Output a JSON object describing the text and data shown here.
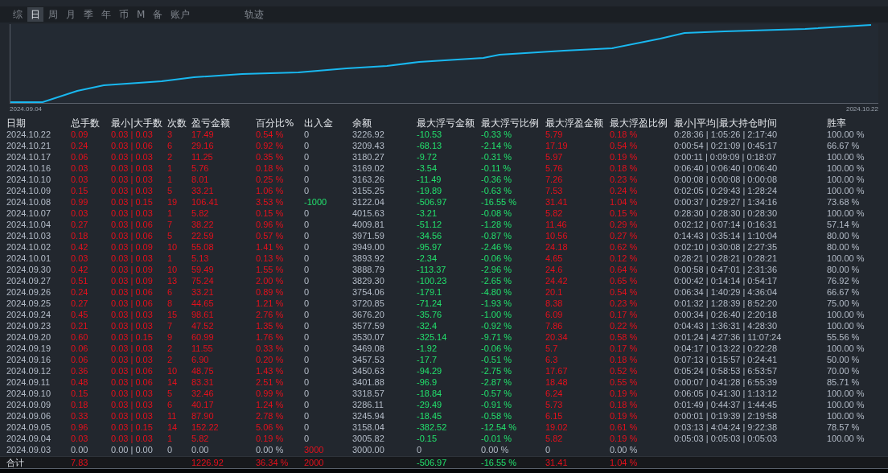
{
  "tabs": [
    {
      "label": "综",
      "selected": false
    },
    {
      "label": "日",
      "selected": true
    },
    {
      "label": "周",
      "selected": false
    },
    {
      "label": "月",
      "selected": false
    },
    {
      "label": "季",
      "selected": false
    },
    {
      "label": "年",
      "selected": false
    },
    {
      "label": "币",
      "selected": false
    },
    {
      "label": "M",
      "selected": false
    },
    {
      "label": "备",
      "selected": false
    },
    {
      "label": "账户",
      "selected": false
    },
    {
      "label": "轨迹",
      "selected": false
    }
  ],
  "chart": {
    "start_label": "2024.09.04",
    "end_label": "2024.10.22"
  },
  "table": {
    "columns": [
      {
        "label": "日期",
        "kind": "neutral"
      },
      {
        "label": "总手数",
        "kind": "gain"
      },
      {
        "label": "最小|大手数",
        "kind": "gain"
      },
      {
        "label": "次数",
        "kind": "gain"
      },
      {
        "label": "盈亏金额",
        "kind": "gain"
      },
      {
        "label": "百分比%",
        "kind": "gain"
      },
      {
        "label": "出入金",
        "kind": "neutral"
      },
      {
        "label": "余额",
        "kind": "neutral"
      },
      {
        "label": "最大浮亏金额",
        "kind": "loss"
      },
      {
        "label": "最大浮亏比例",
        "kind": "loss"
      },
      {
        "label": "最大浮盈金额",
        "kind": "gain"
      },
      {
        "label": "最大浮盈比例",
        "kind": "gain"
      },
      {
        "label": "最小|平均|最大持仓时间",
        "kind": "neutral"
      },
      {
        "label": "胜率",
        "kind": "neutral"
      }
    ],
    "rows": [
      {
        "cells": [
          "2024.10.22",
          "0.09",
          "0.03 | 0.03",
          "3",
          "17.49",
          "0.54 %",
          "0",
          "3226.92",
          "-10.53",
          "-0.33 %",
          "5.79",
          "0.18 %",
          "0:28:36 | 1:05:26 | 2:17:40",
          "100.00 %"
        ]
      },
      {
        "cells": [
          "2024.10.21",
          "0.24",
          "0.03 | 0.06",
          "6",
          "29.16",
          "0.92 %",
          "0",
          "3209.43",
          "-68.13",
          "-2.14 %",
          "17.19",
          "0.54 %",
          "0:00:54 | 0:21:09 | 0:45:17",
          "66.67 %"
        ]
      },
      {
        "cells": [
          "2024.10.17",
          "0.06",
          "0.03 | 0.03",
          "2",
          "11.25",
          "0.35 %",
          "0",
          "3180.27",
          "-9.72",
          "-0.31 %",
          "5.97",
          "0.19 %",
          "0:00:11 | 0:09:09 | 0:18:07",
          "100.00 %"
        ]
      },
      {
        "cells": [
          "2024.10.16",
          "0.03",
          "0.03 | 0.03",
          "1",
          "5.76",
          "0.18 %",
          "0",
          "3169.02",
          "-3.54",
          "-0.11 %",
          "5.76",
          "0.18 %",
          "0:06:40 | 0:06:40 | 0:06:40",
          "100.00 %"
        ]
      },
      {
        "cells": [
          "2024.10.10",
          "0.03",
          "0.03 | 0.03",
          "1",
          "8.01",
          "0.25 %",
          "0",
          "3163.26",
          "-11.49",
          "-0.36 %",
          "7.26",
          "0.23 %",
          "0:00:08 | 0:00:08 | 0:00:08",
          "100.00 %"
        ]
      },
      {
        "cells": [
          "2024.10.09",
          "0.15",
          "0.03 | 0.03",
          "5",
          "33.21",
          "1.06 %",
          "0",
          "3155.25",
          "-19.89",
          "-0.63 %",
          "7.53",
          "0.24 %",
          "0:02:05 | 0:29:43 | 1:28:24",
          "100.00 %"
        ]
      },
      {
        "cells": [
          "2024.10.08",
          "0.99",
          "0.03 | 0.15",
          "19",
          "106.41",
          "3.53 %",
          {
            "text": "-1000",
            "kind": "loss"
          },
          "3122.04",
          "-506.97",
          "-16.55 %",
          "31.41",
          "1.04 %",
          "0:00:37 | 0:29:27 | 1:34:16",
          "73.68 %"
        ]
      },
      {
        "cells": [
          "2024.10.07",
          "0.03",
          "0.03 | 0.03",
          "1",
          "5.82",
          "0.15 %",
          "0",
          "4015.63",
          "-3.21",
          "-0.08 %",
          "5.82",
          "0.15 %",
          "0:28:30 | 0:28:30 | 0:28:30",
          "100.00 %"
        ]
      },
      {
        "cells": [
          "2024.10.04",
          "0.27",
          "0.03 | 0.06",
          "7",
          "38.22",
          "0.96 %",
          "0",
          "4009.81",
          "-51.12",
          "-1.28 %",
          "11.46",
          "0.29 %",
          "0:02:12 | 0:07:14 | 0:16:31",
          "57.14 %"
        ]
      },
      {
        "cells": [
          "2024.10.03",
          "0.18",
          "0.03 | 0.06",
          "5",
          "22.59",
          "0.57 %",
          "0",
          "3971.59",
          "-34.56",
          "-0.87 %",
          "10.56",
          "0.27 %",
          "0:14:43 | 0:35:14 | 1:10:04",
          "80.00 %"
        ]
      },
      {
        "cells": [
          "2024.10.02",
          "0.42",
          "0.03 | 0.09",
          "10",
          "55.08",
          "1.41 %",
          "0",
          "3949.00",
          "-95.97",
          "-2.46 %",
          "24.18",
          "0.62 %",
          "0:02:10 | 0:30:08 | 2:27:35",
          "80.00 %"
        ]
      },
      {
        "cells": [
          "2024.10.01",
          "0.03",
          "0.03 | 0.03",
          "1",
          "5.13",
          "0.13 %",
          "0",
          "3893.92",
          "-2.34",
          "-0.06 %",
          "4.65",
          "0.12 %",
          "0:28:21 | 0:28:21 | 0:28:21",
          "100.00 %"
        ]
      },
      {
        "cells": [
          "2024.09.30",
          "0.42",
          "0.03 | 0.09",
          "10",
          "59.49",
          "1.55 %",
          "0",
          "3888.79",
          "-113.37",
          "-2.96 %",
          "24.6",
          "0.64 %",
          "0:00:58 | 0:47:01 | 2:31:36",
          "80.00 %"
        ]
      },
      {
        "cells": [
          "2024.09.27",
          "0.51",
          "0.03 | 0.09",
          "13",
          "75.24",
          "2.00 %",
          "0",
          "3829.30",
          "-100.23",
          "-2.65 %",
          "24.42",
          "0.65 %",
          "0:00:42 | 0:14:14 | 0:54:17",
          "76.92 %"
        ]
      },
      {
        "cells": [
          "2024.09.26",
          "0.24",
          "0.03 | 0.06",
          "6",
          "33.21",
          "0.89 %",
          "0",
          "3754.06",
          "-179.1",
          "-4.80 %",
          "20.1",
          "0.54 %",
          "0:06:34 | 1:40:29 | 4:36:04",
          "66.67 %"
        ]
      },
      {
        "cells": [
          "2024.09.25",
          "0.27",
          "0.03 | 0.06",
          "8",
          "44.65",
          "1.21 %",
          "0",
          "3720.85",
          "-71.24",
          "-1.93 %",
          "8.38",
          "0.23 %",
          "0:01:32 | 1:28:39 | 8:52:20",
          "75.00 %"
        ]
      },
      {
        "cells": [
          "2024.09.24",
          "0.45",
          "0.03 | 0.03",
          "15",
          "98.61",
          "2.76 %",
          "0",
          "3676.20",
          "-35.76",
          "-1.00 %",
          "6.09",
          "0.17 %",
          "0:00:34 | 0:26:40 | 2:20:18",
          "100.00 %"
        ]
      },
      {
        "cells": [
          "2024.09.23",
          "0.21",
          "0.03 | 0.03",
          "7",
          "47.52",
          "1.35 %",
          "0",
          "3577.59",
          "-32.4",
          "-0.92 %",
          "7.86",
          "0.22 %",
          "0:04:43 | 1:36:31 | 4:28:30",
          "100.00 %"
        ]
      },
      {
        "cells": [
          "2024.09.20",
          "0.60",
          "0.03 | 0.15",
          "9",
          "60.99",
          "1.76 %",
          "0",
          "3530.07",
          "-325.14",
          "-9.71 %",
          "20.34",
          "0.58 %",
          "0:01:24 | 4:27:36 | 11:07:24",
          "55.56 %"
        ]
      },
      {
        "cells": [
          "2024.09.19",
          "0.06",
          "0.03 | 0.03",
          "2",
          "11.55",
          "0.33 %",
          "0",
          "3469.08",
          "-1.92",
          "-0.06 %",
          "5.7",
          "0.17 %",
          "0:04:17 | 0:13:22 | 0:22:28",
          "100.00 %"
        ]
      },
      {
        "cells": [
          "2024.09.16",
          "0.06",
          "0.03 | 0.03",
          "2",
          "6.90",
          "0.20 %",
          "0",
          "3457.53",
          "-17.7",
          "-0.51 %",
          "6.3",
          "0.18 %",
          "0:07:13 | 0:15:57 | 0:24:41",
          "50.00 %"
        ]
      },
      {
        "cells": [
          "2024.09.12",
          "0.36",
          "0.03 | 0.06",
          "10",
          "48.75",
          "1.43 %",
          "0",
          "3450.63",
          "-94.29",
          "-2.75 %",
          "17.67",
          "0.52 %",
          "0:05:24 | 0:58:53 | 6:53:57",
          "70.00 %"
        ]
      },
      {
        "cells": [
          "2024.09.11",
          "0.48",
          "0.03 | 0.06",
          "14",
          "83.31",
          "2.51 %",
          "0",
          "3401.88",
          "-96.9",
          "-2.87 %",
          "18.48",
          "0.55 %",
          "0:00:07 | 0:41:28 | 6:55:39",
          "85.71 %"
        ]
      },
      {
        "cells": [
          "2024.09.10",
          "0.15",
          "0.03 | 0.03",
          "5",
          "32.46",
          "0.99 %",
          "0",
          "3318.57",
          "-18.84",
          "-0.57 %",
          "6.24",
          "0.19 %",
          "0:06:05 | 0:41:30 | 1:13:12",
          "100.00 %"
        ]
      },
      {
        "cells": [
          "2024.09.09",
          "0.18",
          "0.03 | 0.03",
          "6",
          "40.17",
          "1.24 %",
          "0",
          "3286.11",
          "-29.49",
          "-0.91 %",
          "5.73",
          "0.18 %",
          "0:01:49 | 0:44:37 | 1:44:45",
          "100.00 %"
        ]
      },
      {
        "cells": [
          "2024.09.06",
          "0.33",
          "0.03 | 0.03",
          "11",
          "87.90",
          "2.78 %",
          "0",
          "3245.94",
          "-18.45",
          "-0.58 %",
          "6.15",
          "0.19 %",
          "0:00:01 | 0:19:39 | 2:19:58",
          "100.00 %"
        ]
      },
      {
        "cells": [
          "2024.09.05",
          "0.96",
          "0.03 | 0.15",
          "14",
          "152.22",
          "5.06 %",
          "0",
          "3158.04",
          "-382.52",
          "-12.54 %",
          "19.02",
          "0.61 %",
          "0:03:13 | 4:04:24 | 9:22:38",
          "78.57 %"
        ]
      },
      {
        "cells": [
          "2024.09.04",
          "0.03",
          "0.03 | 0.03",
          "1",
          "5.82",
          "0.19 %",
          "0",
          "3005.82",
          "-0.15",
          "-0.01 %",
          "5.82",
          "0.19 %",
          "0:05:03 | 0:05:03 | 0:05:03",
          "100.00 %"
        ]
      },
      {
        "cells": [
          "2024.09.03",
          {
            "text": "0.00",
            "kind": "neutral"
          },
          {
            "text": "0.00 | 0.00",
            "kind": "neutral"
          },
          {
            "text": "0",
            "kind": "neutral"
          },
          {
            "text": "0.00",
            "kind": "neutral"
          },
          {
            "text": "0.00 %",
            "kind": "neutral"
          },
          {
            "text": "3000",
            "kind": "gain"
          },
          "3000.00",
          {
            "text": "0",
            "kind": "neutral"
          },
          {
            "text": "0.00 %",
            "kind": "neutral"
          },
          {
            "text": "0",
            "kind": "neutral"
          },
          {
            "text": "0.00 %",
            "kind": "neutral"
          }
        ]
      }
    ],
    "total": {
      "cells": [
        "合计",
        "7.83",
        null,
        null,
        "1226.92",
        "36.34 %",
        {
          "text": "2000",
          "kind": "gain"
        },
        null,
        "-506.97",
        "-16.55 %",
        "31.41",
        "1.04 %"
      ]
    }
  }
}
